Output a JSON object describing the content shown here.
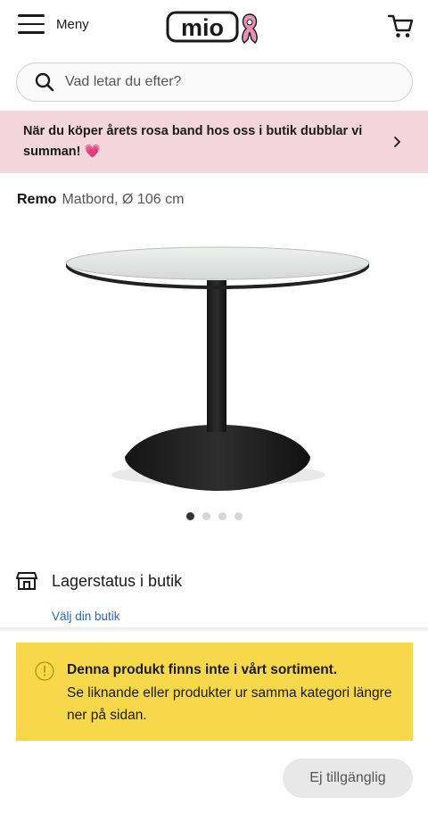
{
  "header": {
    "menu_label": "Meny",
    "logo_text": "mio",
    "cart_icon": "cart-icon"
  },
  "search": {
    "placeholder": "Vad letar du efter?"
  },
  "promo": {
    "text": "När du köper årets rosa band hos oss i butik dubblar vi summan!",
    "emoji": "💗"
  },
  "product": {
    "brand": "Remo",
    "subtitle": "Matbord, Ø 106 cm",
    "image_count": 4,
    "active_image": 1
  },
  "stock": {
    "label": "Lagerstatus i butik",
    "link": "Välj din butik"
  },
  "notice": {
    "title": "Denna produkt finns inte i vårt sortiment.",
    "body": "Se liknande eller produkter ur samma kategori längre ner på sidan."
  },
  "cta": {
    "label": "Ej tillgänglig"
  },
  "colors": {
    "promo_bg": "#f3d5dd",
    "notice_bg": "#f7d84a",
    "link": "#2b6cb0"
  }
}
